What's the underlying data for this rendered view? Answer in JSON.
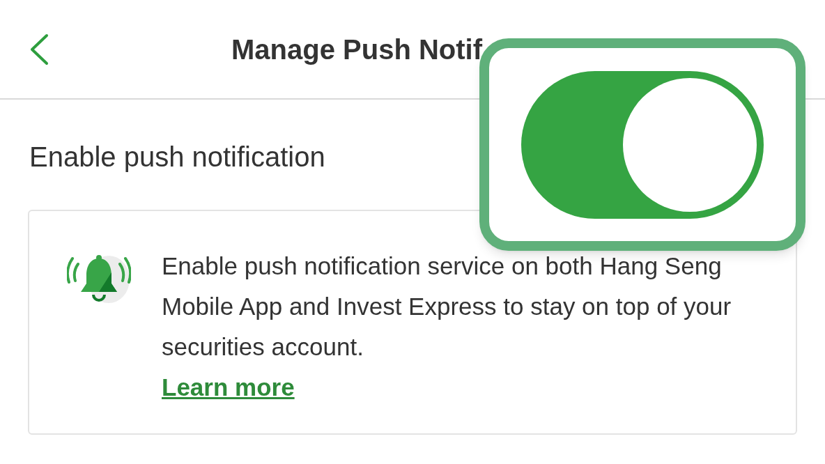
{
  "header": {
    "title": "Manage Push Notif"
  },
  "setting": {
    "label": "Enable push notification",
    "on": true
  },
  "info_card": {
    "text": "Enable push notification service on both Hang Seng Mobile App and Invest Express to stay on top of your securities account.",
    "link": "Learn more"
  }
}
